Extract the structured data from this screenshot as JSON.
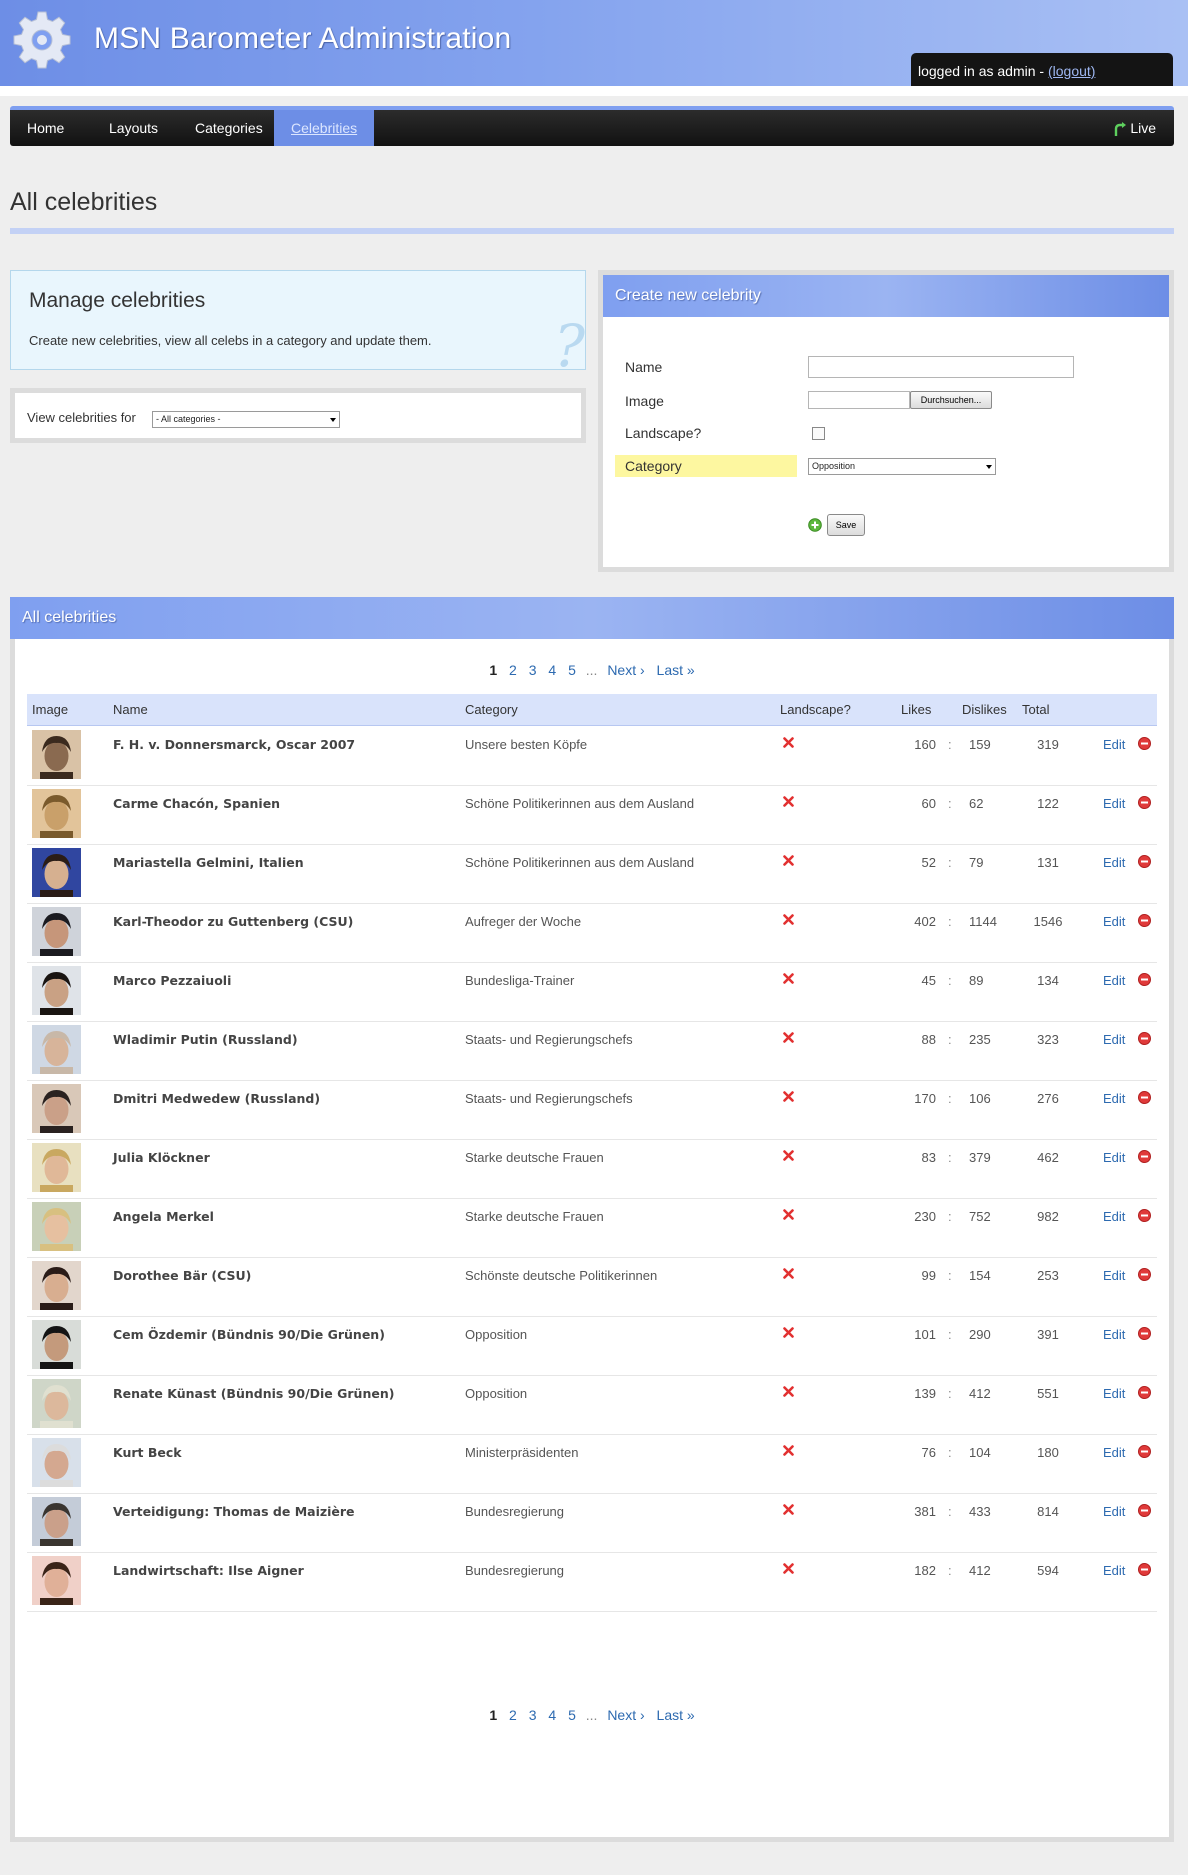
{
  "header": {
    "title": "MSN Barometer Administration",
    "login_text": "logged in as admin - ",
    "logout_label": "(logout)"
  },
  "nav": {
    "items": [
      {
        "label": "Home"
      },
      {
        "label": "Layouts"
      },
      {
        "label": "Categories"
      },
      {
        "label": "Celebrities",
        "active": true
      }
    ],
    "live_label": "Live"
  },
  "page": {
    "title": "All celebrities"
  },
  "manage": {
    "heading": "Manage celebrities",
    "text": "Create new celebrities, view all celebs in a category and update them.",
    "view_label": "View celebrities for",
    "view_select": "- All categories -"
  },
  "create": {
    "heading": "Create new celebrity",
    "name_label": "Name",
    "image_label": "Image",
    "browse_label": "Durchsuchen...",
    "landscape_label": "Landscape?",
    "category_label": "Category",
    "category_value": "Opposition",
    "save_label": "Save"
  },
  "list": {
    "heading": "All celebrities",
    "pager": {
      "pages": [
        "1",
        "2",
        "3",
        "4",
        "5"
      ],
      "dots": "...",
      "next": "Next ›",
      "last": "Last »"
    },
    "columns": {
      "image": "Image",
      "name": "Name",
      "category": "Category",
      "landscape": "Landscape?",
      "likes": "Likes",
      "dislikes": "Dislikes",
      "total": "Total"
    },
    "edit_label": "Edit",
    "sep": ":",
    "rows": [
      {
        "name": "F. H. v. Donnersmarck, Oscar 2007",
        "category": "Unsere besten Köpfe",
        "likes": "160",
        "dislikes": "159",
        "total": "319"
      },
      {
        "name": "Carme Chacón, Spanien",
        "category": "Schöne Politikerinnen aus dem Ausland",
        "likes": "60",
        "dislikes": "62",
        "total": "122"
      },
      {
        "name": "Mariastella Gelmini, Italien",
        "category": "Schöne Politikerinnen aus dem Ausland",
        "likes": "52",
        "dislikes": "79",
        "total": "131"
      },
      {
        "name": "Karl-Theodor zu Guttenberg (CSU)",
        "category": "Aufreger der Woche",
        "likes": "402",
        "dislikes": "1144",
        "total": "1546"
      },
      {
        "name": "Marco Pezzaiuoli",
        "category": "Bundesliga-Trainer",
        "likes": "45",
        "dislikes": "89",
        "total": "134"
      },
      {
        "name": "Wladimir Putin (Russland)",
        "category": "Staats- und Regierungschefs",
        "likes": "88",
        "dislikes": "235",
        "total": "323"
      },
      {
        "name": "Dmitri Medwedew (Russland)",
        "category": "Staats- und Regierungschefs",
        "likes": "170",
        "dislikes": "106",
        "total": "276"
      },
      {
        "name": "Julia Klöckner",
        "category": "Starke deutsche Frauen",
        "likes": "83",
        "dislikes": "379",
        "total": "462"
      },
      {
        "name": "Angela Merkel",
        "category": "Starke deutsche Frauen",
        "likes": "230",
        "dislikes": "752",
        "total": "982"
      },
      {
        "name": "Dorothee Bär (CSU)",
        "category": "Schönste deutsche Politikerinnen",
        "likes": "99",
        "dislikes": "154",
        "total": "253"
      },
      {
        "name": "Cem Özdemir (Bündnis 90/Die Grünen)",
        "category": "Opposition",
        "likes": "101",
        "dislikes": "290",
        "total": "391"
      },
      {
        "name": "Renate Künast (Bündnis 90/Die Grünen)",
        "category": "Opposition",
        "likes": "139",
        "dislikes": "412",
        "total": "551"
      },
      {
        "name": "Kurt Beck",
        "category": "Ministerpräsidenten",
        "likes": "76",
        "dislikes": "104",
        "total": "180"
      },
      {
        "name": "Verteidigung: Thomas de Maizière",
        "category": "Bundesregierung",
        "likes": "381",
        "dislikes": "433",
        "total": "814"
      },
      {
        "name": "Landwirtschaft: Ilse Aigner",
        "category": "Bundesregierung",
        "likes": "182",
        "dislikes": "412",
        "total": "594"
      }
    ]
  },
  "colors": {
    "accent": "#6d8ee6",
    "nav_bg": "#1a1a1a",
    "link": "#2d6ab0",
    "highlight": "#fdf7a0"
  }
}
